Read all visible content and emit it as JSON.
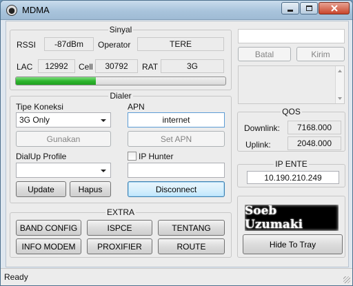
{
  "window": {
    "title": "MDMA"
  },
  "sinyal": {
    "title": "Sinyal",
    "rssi_label": "RSSI",
    "rssi_value": "-87dBm",
    "operator_label": "Operator",
    "operator_value": "TERE",
    "lac_label": "LAC",
    "lac_value": "12992",
    "cell_label": "Cell",
    "cell_value": "30792",
    "rat_label": "RAT",
    "rat_value": "3G",
    "signal_level_percent": 38
  },
  "dialer": {
    "title": "Dialer",
    "tipe_koneksi_label": "Tipe Koneksi",
    "tipe_koneksi_value": "3G Only",
    "gunakan_label": "Gunakan",
    "apn_label": "APN",
    "apn_value": "internet",
    "set_apn_label": "Set APN",
    "dialup_profile_label": "DialUp Profile",
    "dialup_profile_value": "",
    "ip_hunter_label": "IP Hunter",
    "ip_hunter_checked": false,
    "ip_hunter_value": "",
    "update_label": "Update",
    "hapus_label": "Hapus",
    "disconnect_label": "Disconnect"
  },
  "extra": {
    "title": "EXTRA",
    "buttons": [
      "BAND CONFIG",
      "ISPCE",
      "TENTANG",
      "INFO MODEM",
      "PROXIFIER",
      "ROUTE"
    ]
  },
  "sms": {
    "input_value": "",
    "batal_label": "Batal",
    "kirim_label": "Kirim",
    "message_text": ""
  },
  "qos": {
    "title": "QOS",
    "downlink_label": "Downlink:",
    "downlink_value": "7168.000",
    "uplink_label": "Uplink:",
    "uplink_value": "2048.000"
  },
  "ip": {
    "title": "IP ENTE",
    "value": "10.190.210.249"
  },
  "logo_text": "Soeb Uzumaki",
  "hide_to_tray_label": "Hide To Tray",
  "status": {
    "text": "Ready"
  },
  "icons": {
    "app": "app-logo-icon",
    "minimize": "minimize-icon",
    "maximize": "maximize-icon",
    "close": "close-icon",
    "dropdown": "chevron-down-icon",
    "scroll_up": "scroll-up-icon",
    "scroll_down": "scroll-down-icon",
    "grip": "resize-grip-icon"
  },
  "colors": {
    "signal_fill": "#2fb52f",
    "close_button": "#c9462c",
    "titlebar": "#a9c4dc"
  }
}
